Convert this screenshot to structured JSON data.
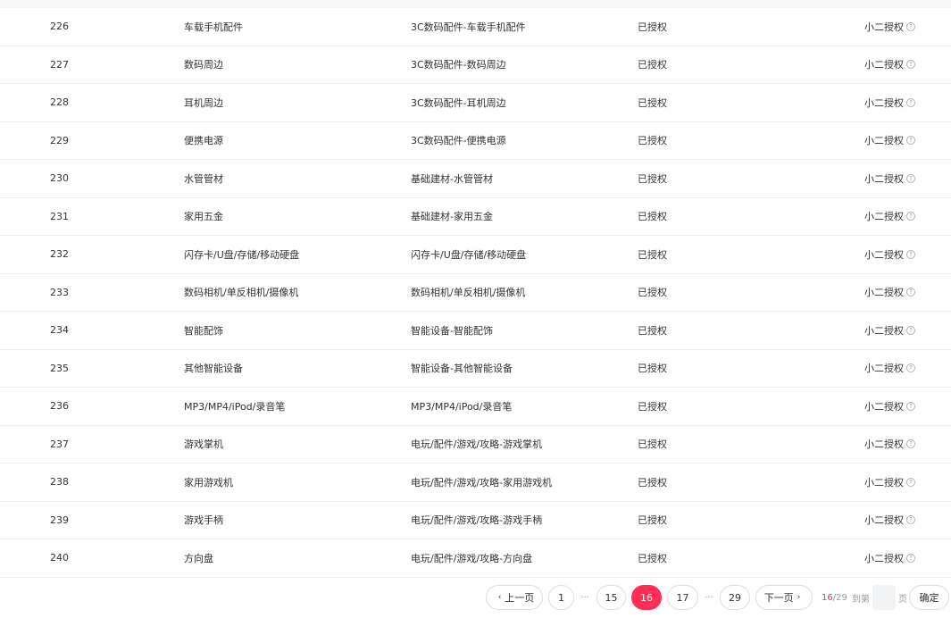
{
  "rows": [
    {
      "id": "226",
      "name": "车载手机配件",
      "path": "3C数码配件-车载手机配件",
      "status": "已授权",
      "source": "小二授权"
    },
    {
      "id": "227",
      "name": "数码周边",
      "path": "3C数码配件-数码周边",
      "status": "已授权",
      "source": "小二授权"
    },
    {
      "id": "228",
      "name": "耳机周边",
      "path": "3C数码配件-耳机周边",
      "status": "已授权",
      "source": "小二授权"
    },
    {
      "id": "229",
      "name": "便携电源",
      "path": "3C数码配件-便携电源",
      "status": "已授权",
      "source": "小二授权"
    },
    {
      "id": "230",
      "name": "水管管材",
      "path": "基础建材-水管管材",
      "status": "已授权",
      "source": "小二授权"
    },
    {
      "id": "231",
      "name": "家用五金",
      "path": "基础建材-家用五金",
      "status": "已授权",
      "source": "小二授权"
    },
    {
      "id": "232",
      "name": "闪存卡/U盘/存储/移动硬盘",
      "path": "闪存卡/U盘/存储/移动硬盘",
      "status": "已授权",
      "source": "小二授权"
    },
    {
      "id": "233",
      "name": "数码相机/单反相机/摄像机",
      "path": "数码相机/单反相机/摄像机",
      "status": "已授权",
      "source": "小二授权"
    },
    {
      "id": "234",
      "name": "智能配饰",
      "path": "智能设备-智能配饰",
      "status": "已授权",
      "source": "小二授权"
    },
    {
      "id": "235",
      "name": "其他智能设备",
      "path": "智能设备-其他智能设备",
      "status": "已授权",
      "source": "小二授权"
    },
    {
      "id": "236",
      "name": "MP3/MP4/iPod/录音笔",
      "path": "MP3/MP4/iPod/录音笔",
      "status": "已授权",
      "source": "小二授权"
    },
    {
      "id": "237",
      "name": "游戏掌机",
      "path": "电玩/配件/游戏/攻略-游戏掌机",
      "status": "已授权",
      "source": "小二授权"
    },
    {
      "id": "238",
      "name": "家用游戏机",
      "path": "电玩/配件/游戏/攻略-家用游戏机",
      "status": "已授权",
      "source": "小二授权"
    },
    {
      "id": "239",
      "name": "游戏手柄",
      "path": "电玩/配件/游戏/攻略-游戏手柄",
      "status": "已授权",
      "source": "小二授权"
    },
    {
      "id": "240",
      "name": "方向盘",
      "path": "电玩/配件/游戏/攻略-方向盘",
      "status": "已授权",
      "source": "小二授权"
    }
  ],
  "pager": {
    "prev_label": "上一页",
    "next_label": "下一页",
    "pages": [
      "1",
      "15",
      "16",
      "17",
      "29"
    ],
    "ellipsis": "···",
    "current_page": "16",
    "total_pages": "29",
    "jump_prefix": "到第",
    "jump_suffix": "页",
    "confirm_label": "确定",
    "active_color": "#ff2e54"
  }
}
